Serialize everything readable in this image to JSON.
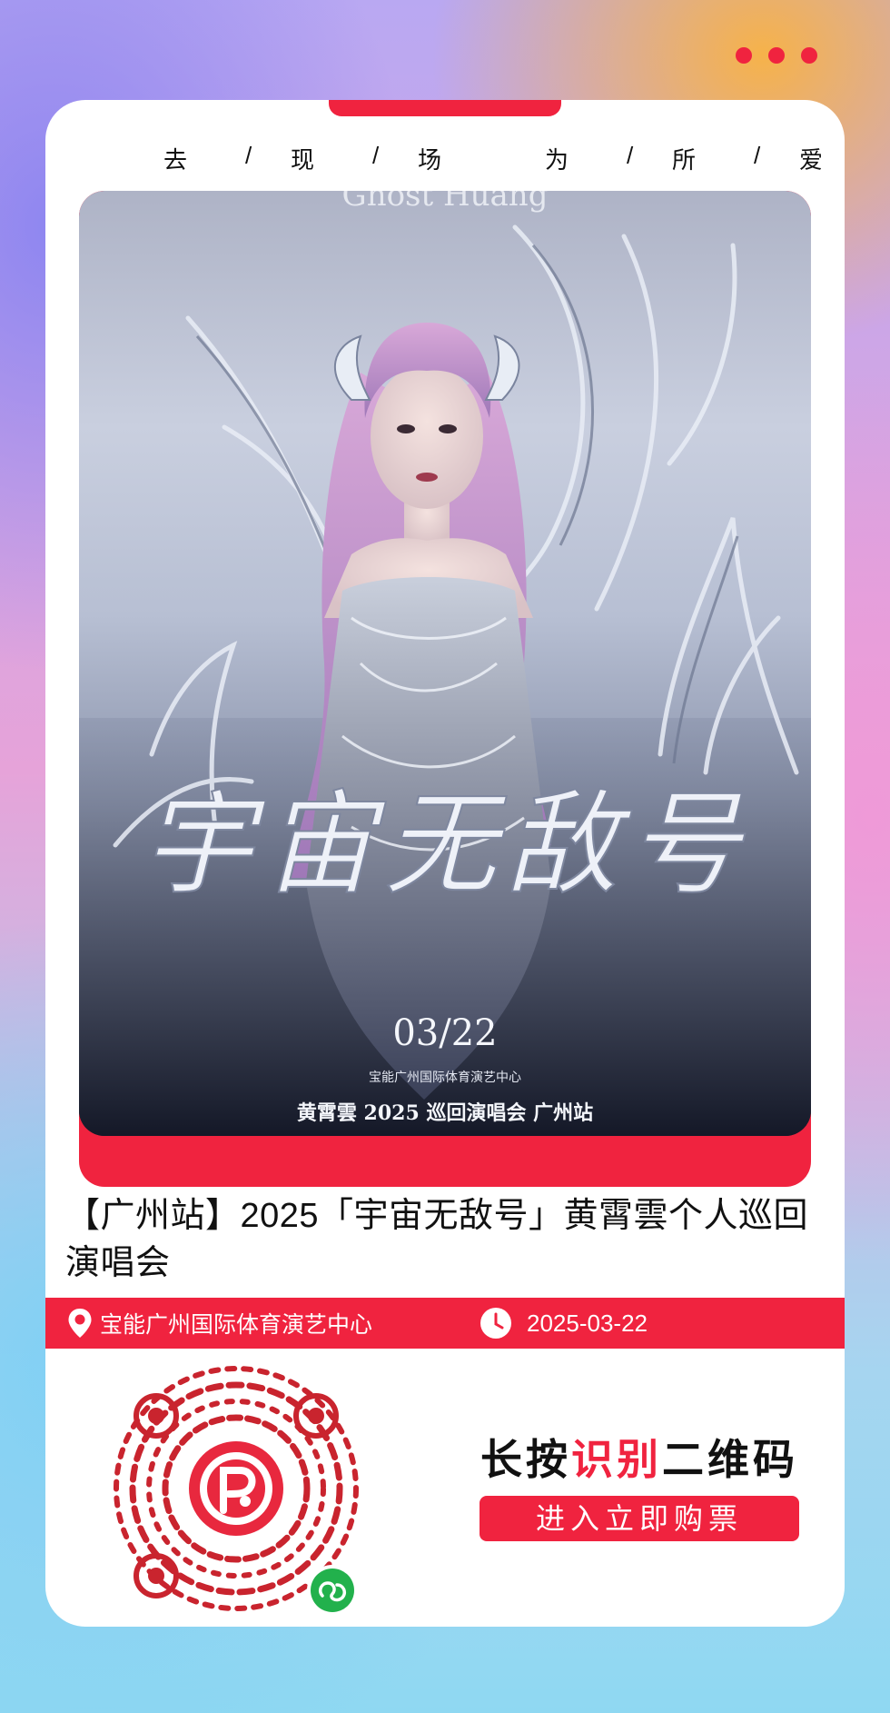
{
  "slogan": {
    "chars": [
      "去",
      "/",
      "现",
      "/",
      "场",
      "为",
      "/",
      "所",
      "/",
      "爱"
    ]
  },
  "poster": {
    "english_artist": "Ghost Huang",
    "calligraphy_title": "宇宙无敌号",
    "date": "03/22",
    "venue": "宝能广州国际体育演艺中心",
    "subtitle": "黄霄雲 2025 巡回演唱会 广州站"
  },
  "event": {
    "title": "【广州站】2025「宇宙无敌号」黄霄雲个人巡回演唱会",
    "venue": "宝能广州国际体育演艺中心",
    "date": "2025-03-22"
  },
  "cta": {
    "prefix": "长按",
    "highlight": "识别",
    "suffix": "二维码",
    "button_label": "进入立即购票"
  },
  "icons": [
    "more-dots-icon",
    "location-pin-icon",
    "clock-icon",
    "qr-code",
    "miniprogram-icon"
  ],
  "colors": {
    "accent": "#f0233f"
  }
}
